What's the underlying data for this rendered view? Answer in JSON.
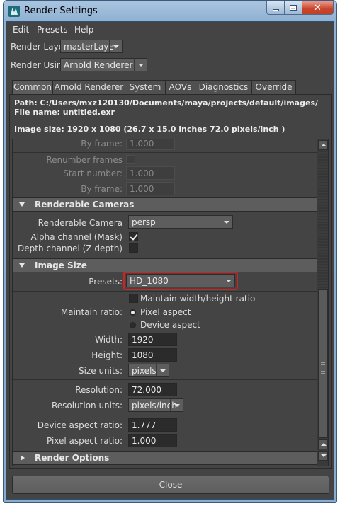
{
  "window": {
    "title": "Render Settings"
  },
  "menubar": {
    "items": [
      "Edit",
      "Presets",
      "Help"
    ]
  },
  "render_layer": {
    "label": "Render Layer",
    "value": "masterLayer"
  },
  "render_using": {
    "label": "Render Using",
    "value": "Arnold Renderer"
  },
  "tabs": [
    "Common",
    "Arnold Renderer",
    "System",
    "AOVs",
    "Diagnostics",
    "Override"
  ],
  "active_tab": "Common",
  "info": {
    "path": "Path: C:/Users/mxz120130/Documents/maya/projects/default/images/",
    "file_name": "File name:  untitled.exr",
    "image_size": "Image size: 1920 x 1080 (26.7 x 15.0 inches 72.0 pixels/inch )"
  },
  "frames": {
    "by_frame_label": "By frame:",
    "by_frame_value": "1.000",
    "renumber_label": "Renumber frames",
    "start_number_label": "Start number:",
    "start_number_value": "1.000",
    "by_frame2_label": "By frame:",
    "by_frame2_value": "1.000"
  },
  "renderable_cameras": {
    "title": "Renderable Cameras",
    "camera_label": "Renderable Camera",
    "camera_value": "persp",
    "alpha_label": "Alpha channel (Mask)",
    "alpha_checked": true,
    "depth_label": "Depth channel (Z depth)",
    "depth_checked": false
  },
  "image_size": {
    "title": "Image Size",
    "presets_label": "Presets:",
    "presets_value": "HD_1080",
    "maintain_wh_label": "Maintain width/height ratio",
    "maintain_ratio_label": "Maintain ratio:",
    "pixel_aspect_label": "Pixel aspect",
    "device_aspect_label": "Device aspect",
    "width_label": "Width:",
    "width_value": "1920",
    "height_label": "Height:",
    "height_value": "1080",
    "size_units_label": "Size units:",
    "size_units_value": "pixels",
    "resolution_label": "Resolution:",
    "resolution_value": "72.000",
    "resolution_units_label": "Resolution units:",
    "resolution_units_value": "pixels/inch",
    "device_aspect_ratio_label": "Device aspect ratio:",
    "device_aspect_ratio_value": "1.777",
    "pixel_aspect_ratio_label": "Pixel aspect ratio:",
    "pixel_aspect_ratio_value": "1.000"
  },
  "render_options": {
    "title": "Render Options"
  },
  "close_button": "Close",
  "colors": {
    "panel_bg": "#444444",
    "section_bg": "#5d5d5d",
    "highlight": "#d42020",
    "titlebar": "#a9c4df"
  }
}
